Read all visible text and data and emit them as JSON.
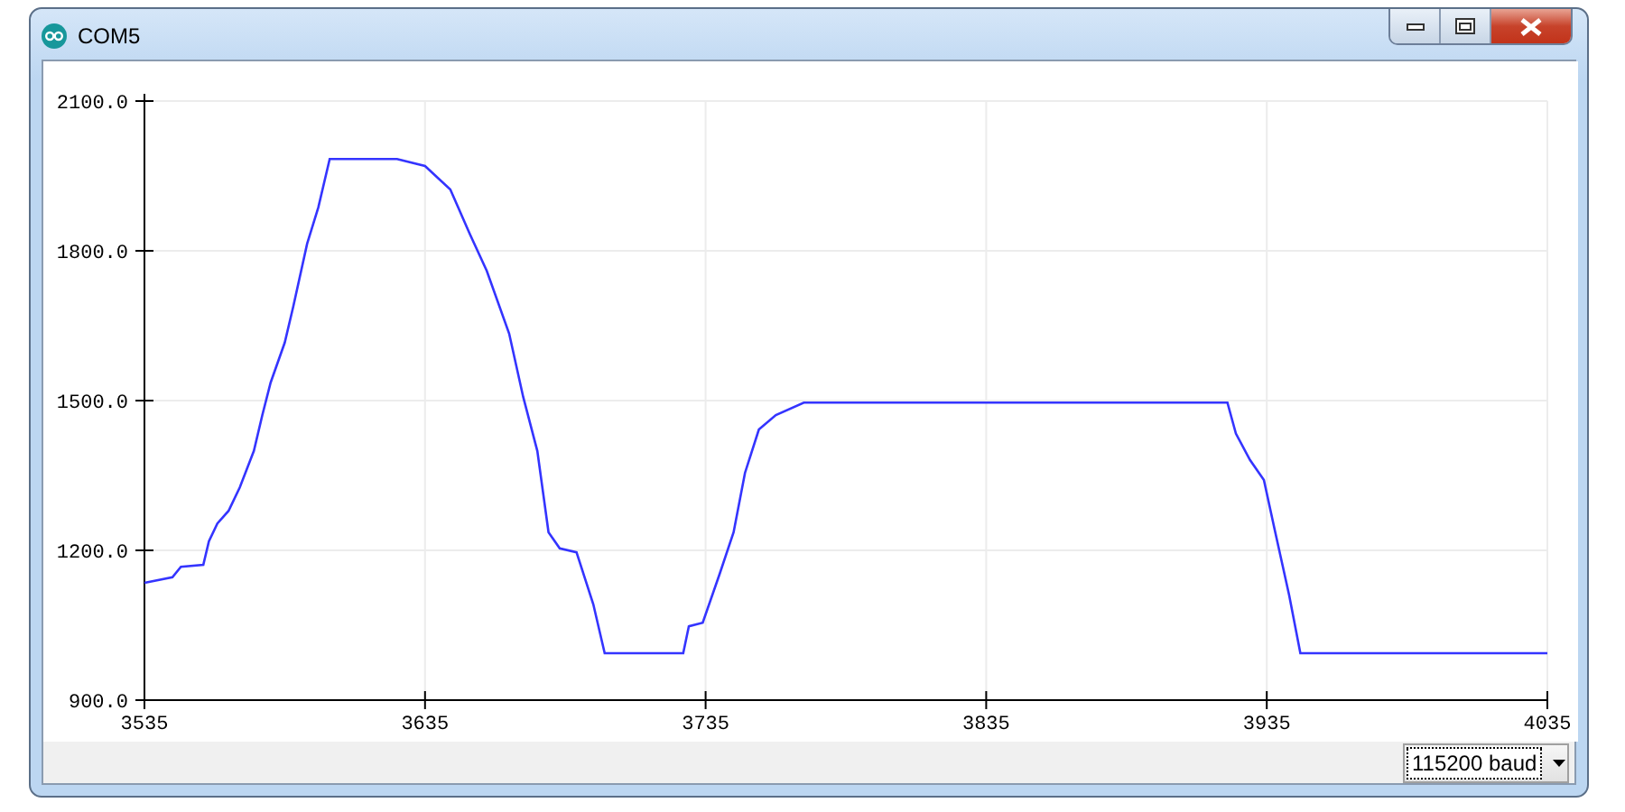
{
  "window": {
    "title": "COM5"
  },
  "plot": {
    "chart_data": {
      "type": "line",
      "grid": true,
      "xlim": [
        3535,
        4035
      ],
      "ylim": [
        900,
        2100
      ],
      "xticks": [
        3535,
        3635,
        3735,
        3835,
        3935,
        4035
      ],
      "yticks": [
        {
          "value": 900,
          "label": "900.0"
        },
        {
          "value": 1200,
          "label": "1200.0"
        },
        {
          "value": 1500,
          "label": "1500.0"
        },
        {
          "value": 1800,
          "label": "1800.0"
        },
        {
          "value": 2100,
          "label": "2100.0"
        }
      ],
      "x": [
        3535,
        3545,
        3548,
        3556,
        3558,
        3561,
        3565,
        3569,
        3574,
        3577,
        3580,
        3585,
        3588,
        3593,
        3597,
        3601,
        3625,
        3635,
        3644,
        3651,
        3657,
        3665,
        3670,
        3675,
        3679,
        3683,
        3689,
        3695,
        3699,
        3727,
        3729,
        3734,
        3740,
        3745,
        3749,
        3754,
        3760,
        3770,
        3921,
        3924,
        3929,
        3934,
        3938,
        3943,
        3947,
        4035
      ],
      "series": [
        {
          "color": "#3434ff",
          "values": [
            1135,
            1146,
            1167,
            1171,
            1218,
            1254,
            1279,
            1326,
            1399,
            1471,
            1536,
            1616,
            1688,
            1814,
            1887,
            1984,
            1984,
            1970,
            1923,
            1833,
            1760,
            1634,
            1507,
            1399,
            1236,
            1204,
            1196,
            1092,
            994,
            994,
            1048,
            1055,
            1153,
            1236,
            1355,
            1442,
            1471,
            1496,
            1496,
            1434,
            1381,
            1341,
            1236,
            1110,
            994,
            994
          ]
        }
      ]
    }
  },
  "baud_select": {
    "value": "115200 baud"
  }
}
